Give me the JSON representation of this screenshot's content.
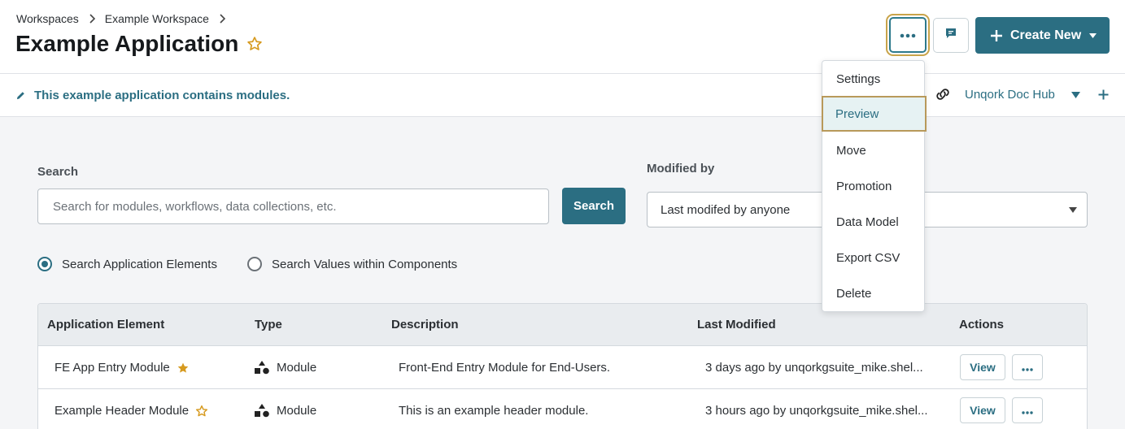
{
  "breadcrumb": {
    "items": [
      "Workspaces",
      "Example Workspace"
    ]
  },
  "page": {
    "title": "Example Application"
  },
  "header_actions": {
    "create_new_label": "Create New"
  },
  "description": {
    "text": "This example application contains modules."
  },
  "doc_hub": {
    "label": "Unqork Doc Hub"
  },
  "search": {
    "label": "Search",
    "placeholder": "Search for modules, workflows, data collections, etc.",
    "value": "",
    "button_label": "Search"
  },
  "modified_by": {
    "label": "Modified by",
    "selected": "Last modifed by anyone"
  },
  "search_scope": {
    "options": [
      {
        "label": "Search Application Elements",
        "selected": true
      },
      {
        "label": "Search Values within Components",
        "selected": false
      }
    ]
  },
  "table": {
    "columns": [
      "Application Element",
      "Type",
      "Description",
      "Last Modified",
      "Actions"
    ],
    "rows": [
      {
        "element": "FE App Entry Module",
        "favorite": true,
        "type": "Module",
        "description": "Front-End Entry Module for End-Users.",
        "last_modified": "3 days ago by unqorkgsuite_mike.shel...",
        "view_label": "View"
      },
      {
        "element": "Example Header Module",
        "favorite": false,
        "type": "Module",
        "description": "This is an example header module.",
        "last_modified": "3 hours ago by unqorkgsuite_mike.shel...",
        "view_label": "View"
      }
    ]
  },
  "more_menu": {
    "items": [
      {
        "label": "Settings",
        "active": false
      },
      {
        "label": "Preview",
        "active": true
      },
      {
        "label": "Move",
        "active": false
      },
      {
        "label": "Promotion",
        "active": false
      },
      {
        "label": "Data Model",
        "active": false
      },
      {
        "label": "Export CSV",
        "active": false
      },
      {
        "label": "Delete",
        "active": false
      }
    ]
  },
  "colors": {
    "accent": "#2b6e82",
    "favorite_star": "#d69a1f",
    "highlight_outline": "#c9a44a"
  }
}
